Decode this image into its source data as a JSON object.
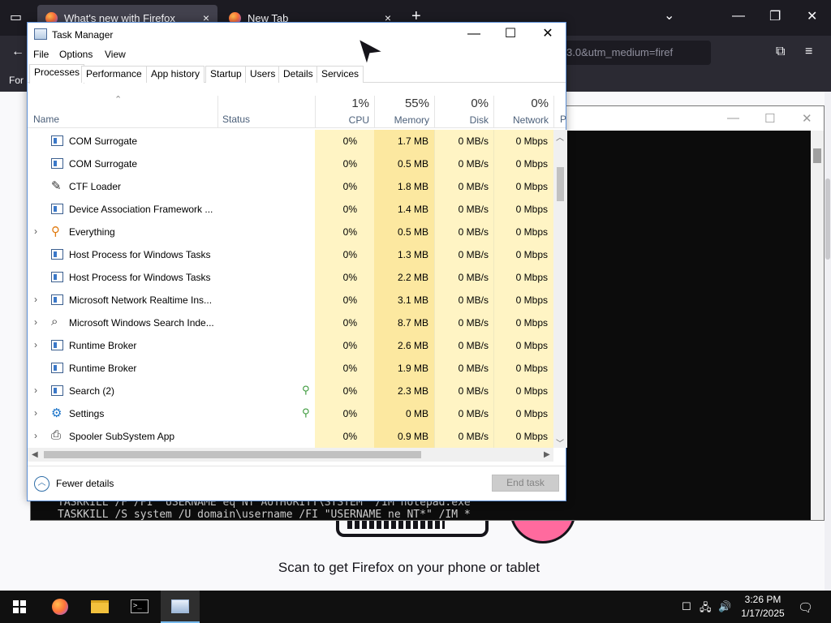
{
  "firefox": {
    "tabs": [
      {
        "title": "What's new with Firefox",
        "close": "×"
      },
      {
        "title": "New Tab",
        "close": "×"
      }
    ],
    "new_tab": "+",
    "url_fragment": "3.0&utm_medium=firef",
    "bookmark_label": "For",
    "caption": "Scan to get Firefox on your phone or tablet"
  },
  "terminal": {
    "lines": [
      "TASKKILL /F /FI \"USERNAME eq NT AUTHORITY\\SYSTEM\" /IM notepad.exe",
      "TASKKILL /S system /U domain\\username /FI \"USERNAME ne NT*\" /IM *"
    ]
  },
  "taskmanager": {
    "title": "Task Manager",
    "menu": [
      "File",
      "Options",
      "View"
    ],
    "tabs": [
      "Processes",
      "Performance",
      "App history",
      "Startup",
      "Users",
      "Details",
      "Services"
    ],
    "active_tab": "Processes",
    "columns": {
      "name": "Name",
      "status": "Status",
      "cpu": {
        "pct": "1%",
        "label": "CPU"
      },
      "memory": {
        "pct": "55%",
        "label": "Memory"
      },
      "disk": {
        "pct": "0%",
        "label": "Disk"
      },
      "network": {
        "pct": "0%",
        "label": "Network"
      },
      "power": "P"
    },
    "rows": [
      {
        "name": "COM Surrogate",
        "expand": "",
        "icon": "window-app-icon",
        "cpu": "0%",
        "mem": "1.7 MB",
        "disk": "0 MB/s",
        "net": "0 Mbps",
        "leaf": ""
      },
      {
        "name": "COM Surrogate",
        "expand": "",
        "icon": "window-app-icon",
        "cpu": "0%",
        "mem": "0.5 MB",
        "disk": "0 MB/s",
        "net": "0 Mbps",
        "leaf": ""
      },
      {
        "name": "CTF Loader",
        "expand": "",
        "icon": "ctf-loader-icon",
        "cpu": "0%",
        "mem": "1.8 MB",
        "disk": "0 MB/s",
        "net": "0 Mbps",
        "leaf": ""
      },
      {
        "name": "Device Association Framework ...",
        "expand": "",
        "icon": "window-app-icon",
        "cpu": "0%",
        "mem": "1.4 MB",
        "disk": "0 MB/s",
        "net": "0 Mbps",
        "leaf": ""
      },
      {
        "name": "Everything",
        "expand": "›",
        "icon": "everything-search-icon",
        "cpu": "0%",
        "mem": "0.5 MB",
        "disk": "0 MB/s",
        "net": "0 Mbps",
        "leaf": ""
      },
      {
        "name": "Host Process for Windows Tasks",
        "expand": "",
        "icon": "window-app-icon",
        "cpu": "0%",
        "mem": "1.3 MB",
        "disk": "0 MB/s",
        "net": "0 Mbps",
        "leaf": ""
      },
      {
        "name": "Host Process for Windows Tasks",
        "expand": "",
        "icon": "window-app-icon",
        "cpu": "0%",
        "mem": "2.2 MB",
        "disk": "0 MB/s",
        "net": "0 Mbps",
        "leaf": ""
      },
      {
        "name": "Microsoft Network Realtime Ins...",
        "expand": "›",
        "icon": "window-app-icon",
        "cpu": "0%",
        "mem": "3.1 MB",
        "disk": "0 MB/s",
        "net": "0 Mbps",
        "leaf": ""
      },
      {
        "name": "Microsoft Windows Search Inde...",
        "expand": "›",
        "icon": "search-indexer-icon",
        "cpu": "0%",
        "mem": "8.7 MB",
        "disk": "0 MB/s",
        "net": "0 Mbps",
        "leaf": ""
      },
      {
        "name": "Runtime Broker",
        "expand": "›",
        "icon": "window-app-icon",
        "cpu": "0%",
        "mem": "2.6 MB",
        "disk": "0 MB/s",
        "net": "0 Mbps",
        "leaf": ""
      },
      {
        "name": "Runtime Broker",
        "expand": "",
        "icon": "window-app-icon",
        "cpu": "0%",
        "mem": "1.9 MB",
        "disk": "0 MB/s",
        "net": "0 Mbps",
        "leaf": ""
      },
      {
        "name": "Search (2)",
        "expand": "›",
        "icon": "window-app-icon",
        "cpu": "0%",
        "mem": "2.3 MB",
        "disk": "0 MB/s",
        "net": "0 Mbps",
        "leaf": "suspended"
      },
      {
        "name": "Settings",
        "expand": "›",
        "icon": "settings-gear-icon",
        "cpu": "0%",
        "mem": "0 MB",
        "disk": "0 MB/s",
        "net": "0 Mbps",
        "leaf": "suspended"
      },
      {
        "name": "Spooler SubSystem App",
        "expand": "›",
        "icon": "printer-icon",
        "cpu": "0%",
        "mem": "0.9 MB",
        "disk": "0 MB/s",
        "net": "0 Mbps",
        "leaf": ""
      }
    ],
    "footer": {
      "fewer_details": "Fewer details",
      "end_task": "End task"
    }
  },
  "taskbar": {
    "time": "3:26 PM",
    "date": "1/17/2025"
  },
  "colors": {
    "heatmap_light": "#fff4c4",
    "heatmap_memory": "#fce8a0",
    "firefox_dark": "#1c1b22",
    "taskbar": "#101010"
  }
}
